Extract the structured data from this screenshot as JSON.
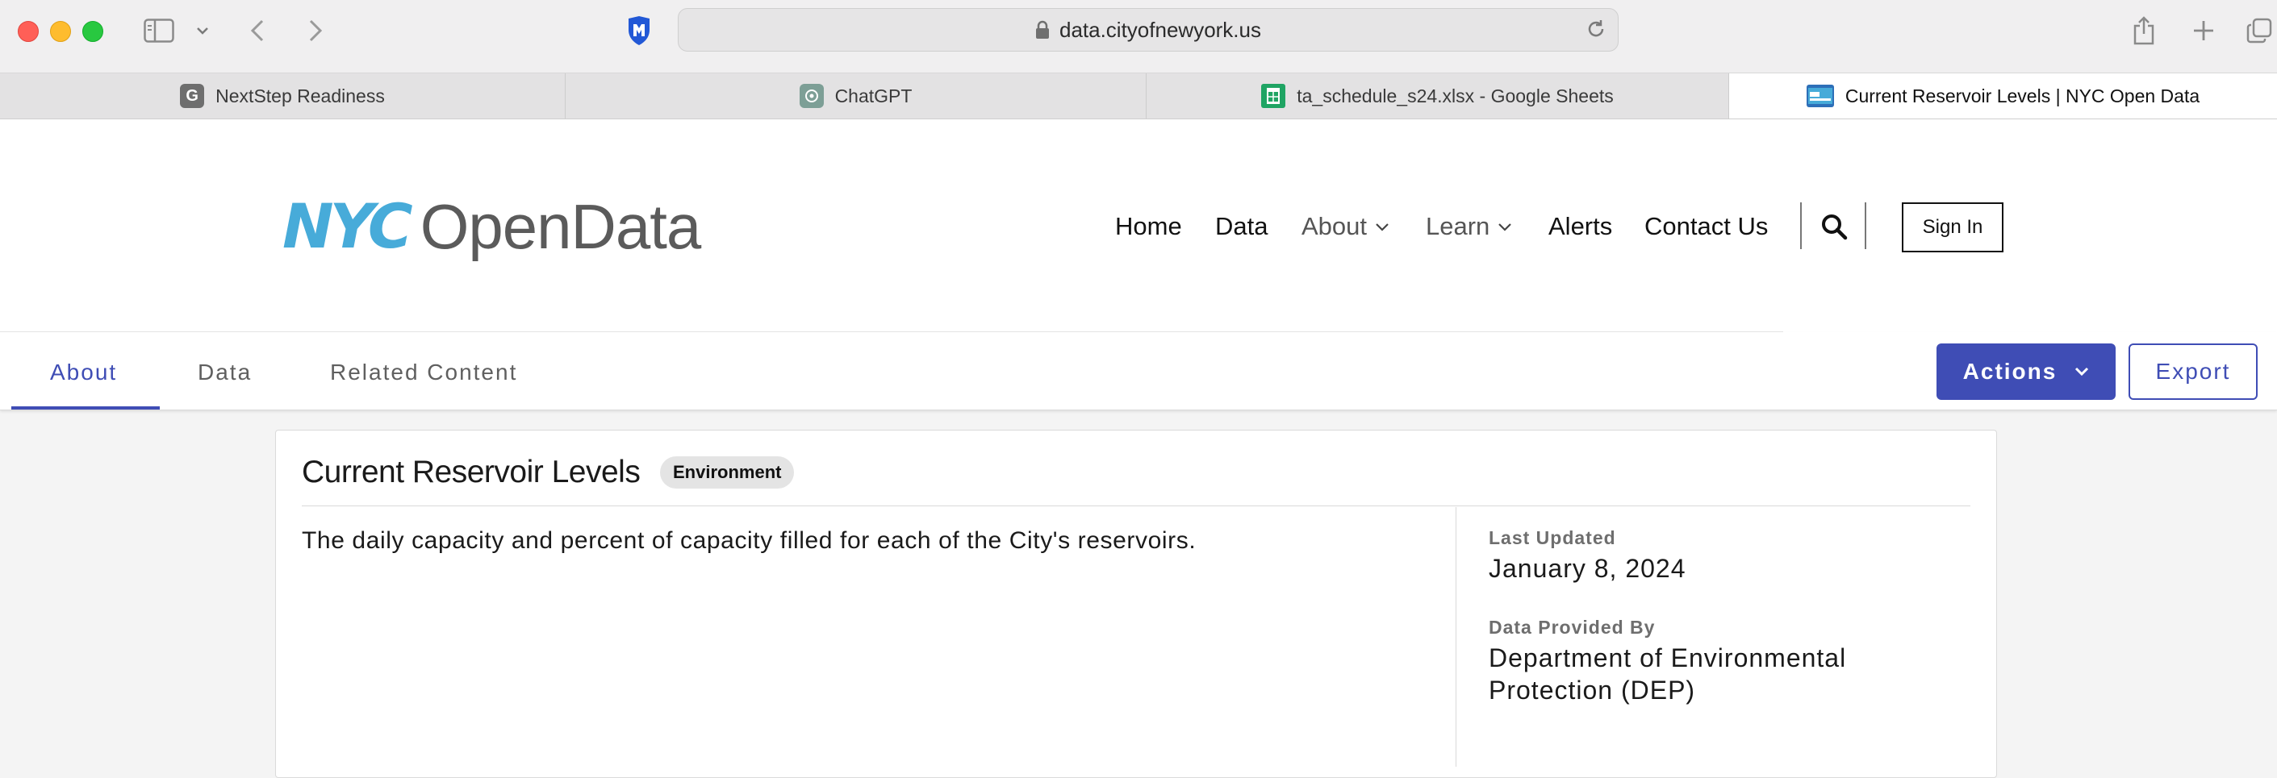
{
  "browser": {
    "url": "data.cityofnewyork.us",
    "tabs": [
      {
        "title": "NextStep Readiness",
        "favicon": "G"
      },
      {
        "title": "ChatGPT",
        "favicon": "chatgpt-icon"
      },
      {
        "title": "ta_schedule_s24.xlsx - Google Sheets",
        "favicon": "sheets-icon"
      },
      {
        "title": "Current Reservoir Levels | NYC Open Data",
        "favicon": "nyc-icon",
        "active": true
      }
    ]
  },
  "site": {
    "logo_nyc": "NYC",
    "logo_opendata": "OpenData",
    "nav": {
      "home": "Home",
      "data": "Data",
      "about": "About",
      "learn": "Learn",
      "alerts": "Alerts",
      "contact": "Contact Us"
    },
    "sign_in": "Sign In"
  },
  "subnav": {
    "tabs": [
      "About",
      "Data",
      "Related Content"
    ],
    "active": "About",
    "actions": "Actions",
    "export": "Export"
  },
  "dataset": {
    "title": "Current Reservoir Levels",
    "category": "Environment",
    "description": "The daily capacity and percent of capacity filled for each of the City's reservoirs.",
    "last_updated_label": "Last Updated",
    "last_updated": "January 8, 2024",
    "provided_by_label": "Data Provided By",
    "provided_by": "Department of Environmental Protection (DEP)"
  },
  "colors": {
    "accent": "#3f4db5",
    "nyc_blue": "#47abd9"
  }
}
